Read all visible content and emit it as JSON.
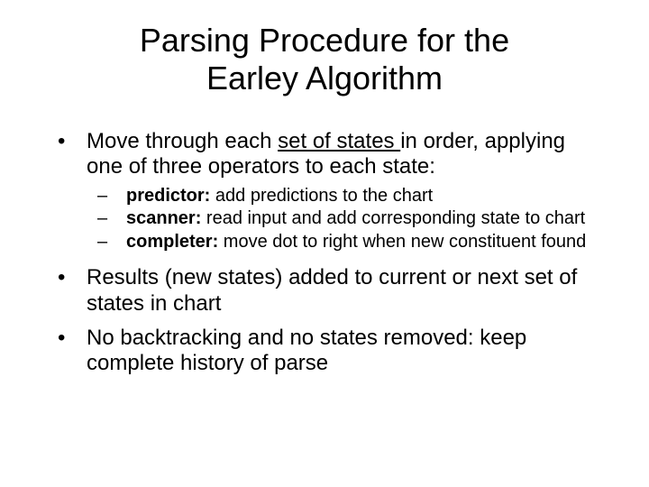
{
  "title_line1": "Parsing Procedure for the",
  "title_line2": "Earley Algorithm",
  "bullet1_a": "Move through each ",
  "bullet1_u": "set of states ",
  "bullet1_b": "in order, applying one of three operators to each state:",
  "sub1_bold": "predictor:",
  "sub1_rest": " add predictions to the chart",
  "sub2_bold": "scanner:",
  "sub2_rest": " read input and add corresponding state to chart",
  "sub3_bold": "completer:",
  "sub3_rest": " move dot to right when new constituent found",
  "bullet2": "Results (new states) added to current or next set of states in chart",
  "bullet3": "No backtracking and no states removed: keep complete history of parse"
}
